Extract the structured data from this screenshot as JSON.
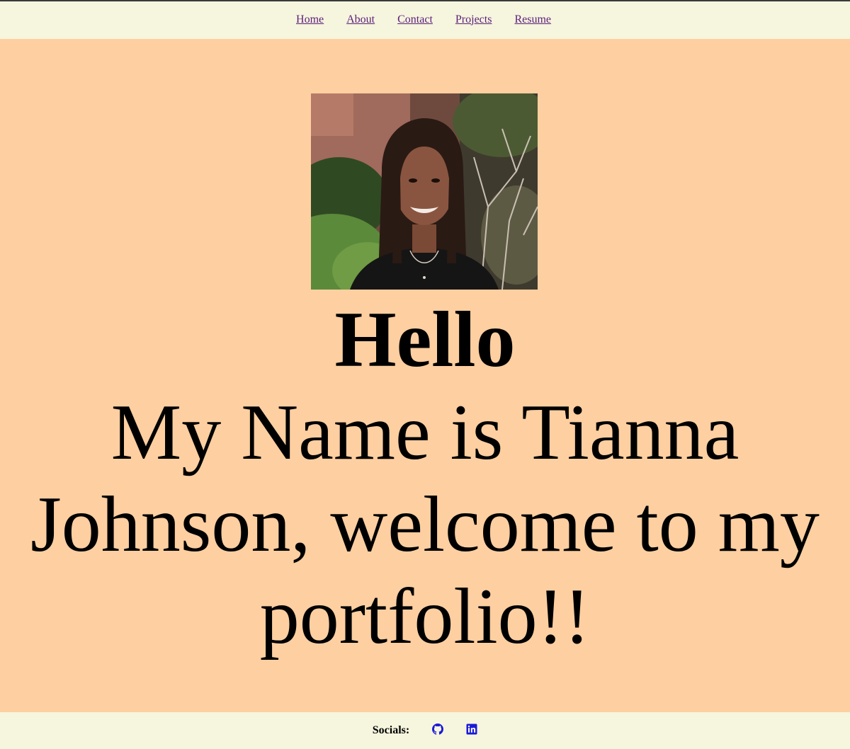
{
  "nav": {
    "items": [
      {
        "label": "Home"
      },
      {
        "label": "About"
      },
      {
        "label": "Contact"
      },
      {
        "label": "Projects"
      },
      {
        "label": "Resume"
      }
    ]
  },
  "hero": {
    "portrait_alt": "Portrait photo of Tianna Johnson",
    "greeting": "Hello",
    "intro": "My Name is Tianna Johnson, welcome to my portfolio!!"
  },
  "footer": {
    "socials_label": "Socials:",
    "links": [
      {
        "icon": "github-icon"
      },
      {
        "icon": "linkedin-icon"
      }
    ]
  },
  "colors": {
    "page_background": "#fdcfa1",
    "bar_background": "#f6f5de",
    "nav_link": "#5a1f7a",
    "social_icon": "#1a1ad6"
  }
}
